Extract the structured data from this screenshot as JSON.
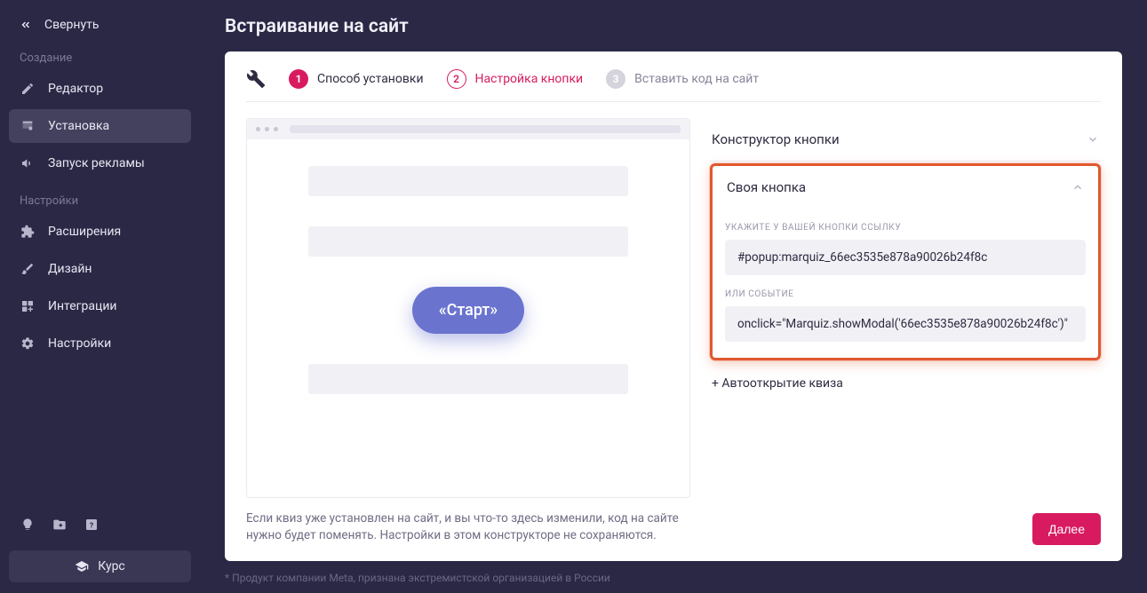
{
  "sidebar": {
    "collapse": "Свернуть",
    "section_create": "Создание",
    "section_settings": "Настройки",
    "items": {
      "editor": "Редактор",
      "install": "Установка",
      "ads": "Запуск рекламы",
      "extensions": "Расширения",
      "design": "Дизайн",
      "integrations": "Интеграции",
      "settings": "Настройки"
    },
    "course": "Курс"
  },
  "page": {
    "title": "Встраивание на сайт"
  },
  "steps": {
    "s1": {
      "num": "1",
      "label": "Способ установки"
    },
    "s2": {
      "num": "2",
      "label": "Настройка кнопки"
    },
    "s3": {
      "num": "3",
      "label": "Вставить код на сайт"
    }
  },
  "preview": {
    "button_label": "«Старт»"
  },
  "accordion": {
    "constructor": "Конструктор кнопки",
    "own_button": "Своя кнопка",
    "auto_open": "+ Автооткрытие квиза"
  },
  "own_button": {
    "label_link": "УКАЖИТЕ У ВАШЕЙ КНОПКИ ССЫЛКУ",
    "value_link": "#popup:marquiz_66ec3535e878a90026b24f8c",
    "label_event": "ИЛИ СОБЫТИЕ",
    "value_event": "onclick=\"Marquiz.showModal('66ec3535e878a90026b24f8c')\""
  },
  "note": "Если квиз уже установлен на сайт, и вы что-то здесь изменили, код на сайте нужно будет поменять. Настройки в этом конструкторе не сохраняются.",
  "next": "Далее",
  "footer": "* Продукт компании Meta, признана экстремистской организацией в России"
}
